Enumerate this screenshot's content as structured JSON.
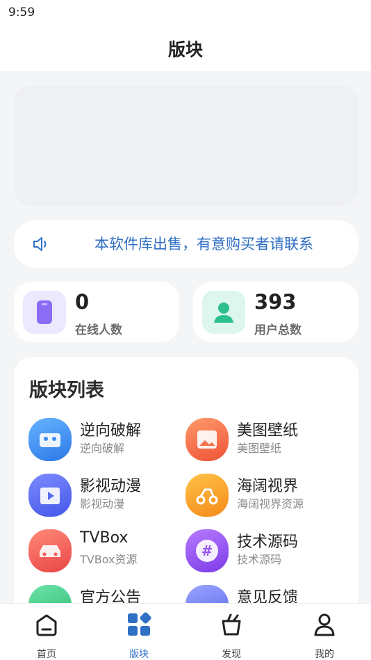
{
  "status_bar": {
    "time": "9:59"
  },
  "header": {
    "title": "版块"
  },
  "notice": {
    "text": "本软件库出售，有意购买者请联系"
  },
  "stats": [
    {
      "value": "0",
      "label": "在线人数",
      "icon": "phone-icon",
      "color": "#8a6cf5"
    },
    {
      "value": "393",
      "label": "用户总数",
      "icon": "user-icon",
      "color": "#2ebf8f"
    }
  ],
  "board": {
    "title": "版块列表",
    "items": [
      {
        "title": "逆向破解",
        "subtitle": "逆向破解",
        "icon": "car-front-icon",
        "color": "#3b8bf0"
      },
      {
        "title": "美图壁纸",
        "subtitle": "美图壁纸",
        "icon": "picture-icon",
        "color": "#f5714a"
      },
      {
        "title": "影视动漫",
        "subtitle": "影视动漫",
        "icon": "video-clapper-icon",
        "color": "#5a6cf0"
      },
      {
        "title": "海阔视界",
        "subtitle": "海阔视界资源",
        "icon": "scooter-icon",
        "color": "#f7a22a"
      },
      {
        "title": "TVBox",
        "subtitle": "TVBox资源",
        "icon": "car-icon",
        "color": "#f05a57"
      },
      {
        "title": "技术源码",
        "subtitle": "技术源码",
        "icon": "hashtag-icon",
        "color": "#9a52f0"
      },
      {
        "title": "官方公告",
        "subtitle": "",
        "icon": "heart-icon",
        "color": "#3fcf8a"
      },
      {
        "title": "意见反馈",
        "subtitle": "",
        "icon": "feedback-icon",
        "color": "#6f7cf5"
      }
    ]
  },
  "tabs": [
    {
      "label": "首页",
      "icon": "home-icon",
      "active": false
    },
    {
      "label": "版块",
      "icon": "grid-icon",
      "active": true
    },
    {
      "label": "发现",
      "icon": "shopping-bag-icon",
      "active": false
    },
    {
      "label": "我的",
      "icon": "user-icon",
      "active": false
    }
  ],
  "colors": {
    "accent": "#2f6fc4",
    "background": "#f4f5f7"
  }
}
